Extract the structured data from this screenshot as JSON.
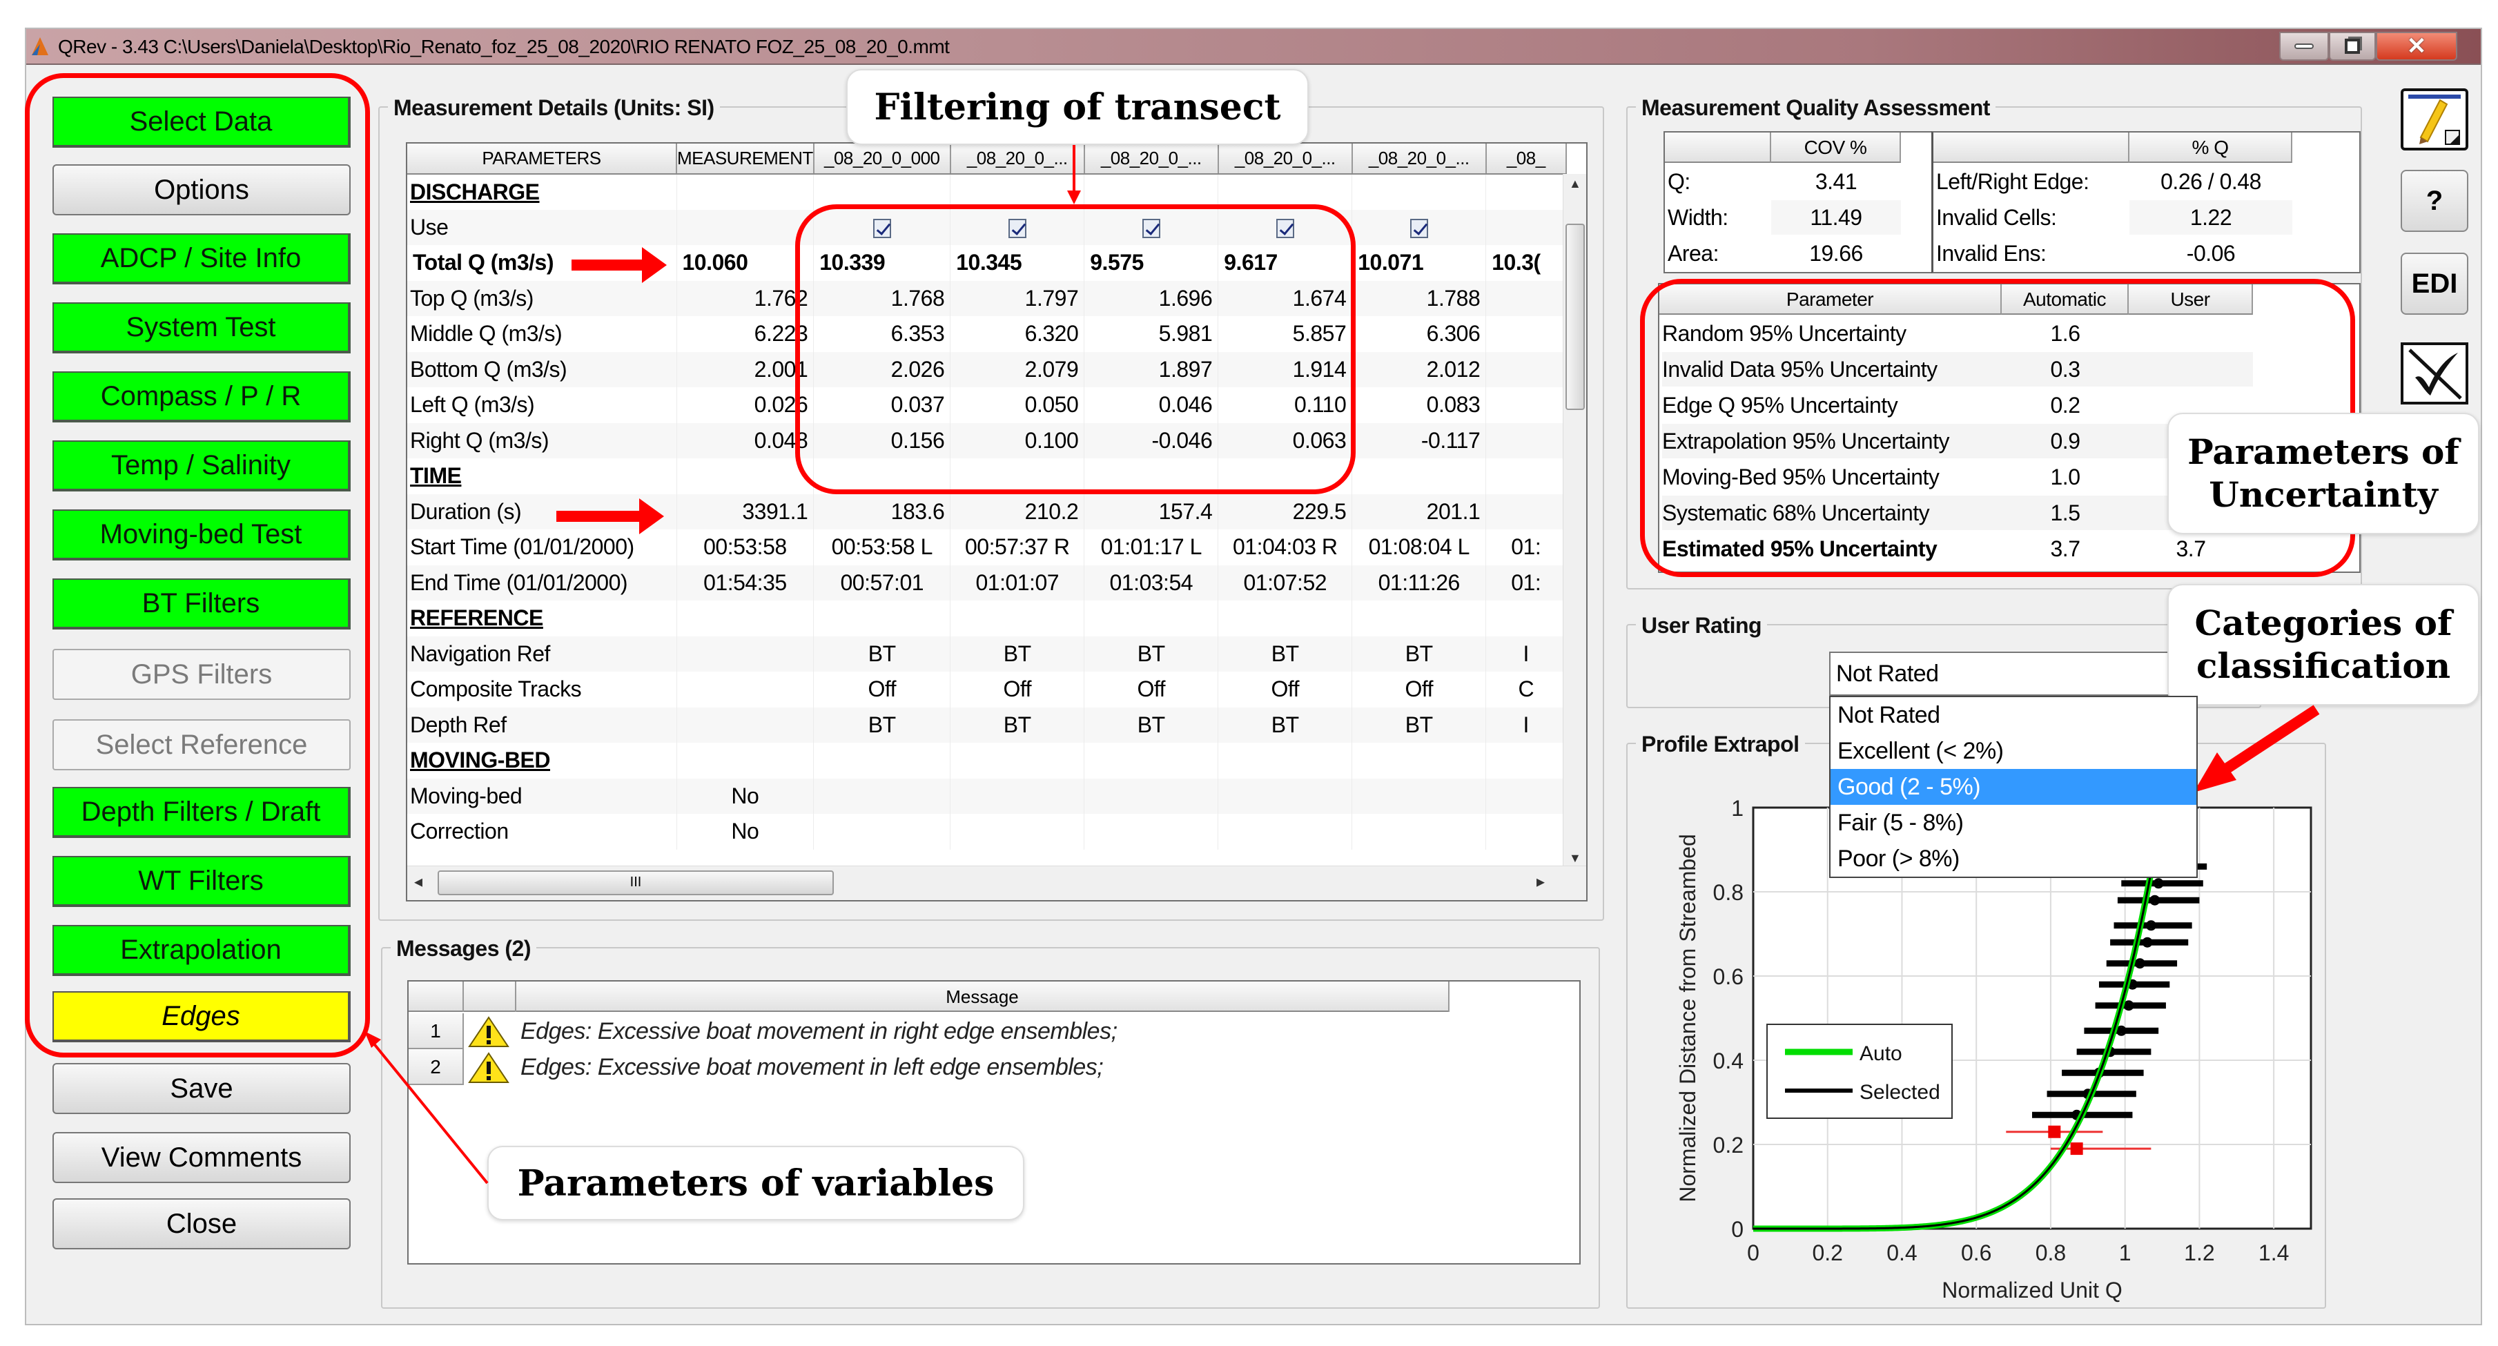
{
  "window": {
    "title": "QRev - 3.43    C:\\Users\\Daniela\\Desktop\\Rio_Renato_foz_25_08_2020\\RIO RENATO FOZ_25_08_20_0.mmt",
    "controls": [
      "minimize",
      "restore",
      "close"
    ]
  },
  "nav": {
    "buttons": [
      {
        "label": "Select Data",
        "state": "green"
      },
      {
        "label": "Options",
        "state": "gray"
      },
      {
        "label": "ADCP / Site Info",
        "state": "green"
      },
      {
        "label": "System Test",
        "state": "green"
      },
      {
        "label": "Compass / P / R",
        "state": "green"
      },
      {
        "label": "Temp / Salinity",
        "state": "green"
      },
      {
        "label": "Moving-bed Test",
        "state": "green"
      },
      {
        "label": "BT Filters",
        "state": "green"
      },
      {
        "label": "GPS Filters",
        "state": "disabled"
      },
      {
        "label": "Select Reference",
        "state": "disabled"
      },
      {
        "label": "Depth Filters / Draft",
        "state": "green"
      },
      {
        "label": "WT Filters",
        "state": "green"
      },
      {
        "label": "Extrapolation",
        "state": "green"
      },
      {
        "label": "Edges",
        "state": "yellow"
      },
      {
        "label": "Save",
        "state": "gray"
      },
      {
        "label": "View Comments",
        "state": "gray"
      },
      {
        "label": "Close",
        "state": "gray"
      }
    ]
  },
  "details": {
    "title": "Measurement Details (Units: SI)",
    "columns": [
      "PARAMETERS",
      "MEASUREMENT",
      "_08_20_0_000",
      "_08_20_0_...",
      "_08_20_0_...",
      "_08_20_0_...",
      "_08_20_0_...",
      "_08_"
    ],
    "rows": [
      {
        "type": "section",
        "label": "DISCHARGE"
      },
      {
        "type": "check",
        "label": "Use",
        "values": [
          "",
          "1",
          "1",
          "1",
          "1",
          "1",
          ""
        ]
      },
      {
        "type": "bold",
        "label": "Total Q (m3/s)",
        "values": [
          "10.060",
          "10.339",
          "10.345",
          "9.575",
          "9.617",
          "10.071",
          "10.3("
        ]
      },
      {
        "type": "num",
        "label": "Top Q (m3/s)",
        "values": [
          "1.762",
          "1.768",
          "1.797",
          "1.696",
          "1.674",
          "1.788",
          ""
        ]
      },
      {
        "type": "num",
        "label": "Middle Q (m3/s)",
        "values": [
          "6.223",
          "6.353",
          "6.320",
          "5.981",
          "5.857",
          "6.306",
          ""
        ]
      },
      {
        "type": "num",
        "label": "Bottom Q (m3/s)",
        "values": [
          "2.001",
          "2.026",
          "2.079",
          "1.897",
          "1.914",
          "2.012",
          ""
        ]
      },
      {
        "type": "num",
        "label": "Left Q (m3/s)",
        "values": [
          "0.026",
          "0.037",
          "0.050",
          "0.046",
          "0.110",
          "0.083",
          ""
        ]
      },
      {
        "type": "num",
        "label": "Right Q (m3/s)",
        "values": [
          "0.048",
          "0.156",
          "0.100",
          "-0.046",
          "0.063",
          "-0.117",
          ""
        ]
      },
      {
        "type": "section",
        "label": "TIME"
      },
      {
        "type": "num",
        "label": "Duration (s)",
        "values": [
          "3391.1",
          "183.6",
          "210.2",
          "157.4",
          "229.5",
          "201.1",
          ""
        ]
      },
      {
        "type": "num",
        "label": "Start Time (01/01/2000)",
        "values": [
          "00:53:58",
          "00:53:58 L",
          "00:57:37 R",
          "01:01:17 L",
          "01:04:03 R",
          "01:08:04 L",
          "01:"
        ]
      },
      {
        "type": "num",
        "label": "End Time (01/01/2000)",
        "values": [
          "01:54:35",
          "00:57:01",
          "01:01:07",
          "01:03:54",
          "01:07:52",
          "01:11:26",
          "01:"
        ]
      },
      {
        "type": "section",
        "label": "REFERENCE"
      },
      {
        "type": "ctr",
        "label": "Navigation Ref",
        "values": [
          "",
          "BT",
          "BT",
          "BT",
          "BT",
          "BT",
          "I"
        ]
      },
      {
        "type": "ctr",
        "label": "Composite Tracks",
        "values": [
          "",
          "Off",
          "Off",
          "Off",
          "Off",
          "Off",
          "C"
        ]
      },
      {
        "type": "ctr",
        "label": "Depth Ref",
        "values": [
          "",
          "BT",
          "BT",
          "BT",
          "BT",
          "BT",
          "I"
        ]
      },
      {
        "type": "section",
        "label": "MOVING-BED"
      },
      {
        "type": "ctr",
        "label": "Moving-bed",
        "values": [
          "No",
          "",
          "",
          "",
          "",
          "",
          ""
        ]
      },
      {
        "type": "ctr",
        "label": "Correction",
        "values": [
          "No",
          "",
          "",
          "",
          "",
          "",
          ""
        ]
      }
    ],
    "hscroll_glyph": "III"
  },
  "messages": {
    "title": "Messages (2)",
    "column": "Message",
    "items": [
      {
        "num": "1",
        "text": "Edges: Excessive boat movement in right edge ensembles;"
      },
      {
        "num": "2",
        "text": "Edges: Excessive boat movement in left edge ensembles;"
      }
    ]
  },
  "quality": {
    "title": "Measurement Quality Assessment",
    "cov": {
      "header": "COV %",
      "rows": [
        {
          "label": "Q:",
          "value": "3.41"
        },
        {
          "label": "Width:",
          "value": "11.49"
        },
        {
          "label": "Area:",
          "value": "19.66"
        }
      ]
    },
    "pctq": {
      "header": "% Q",
      "rows": [
        {
          "label": "Left/Right Edge:",
          "value": "0.26 /   0.48"
        },
        {
          "label": "Invalid Cells:",
          "value": "1.22"
        },
        {
          "label": "Invalid Ens:",
          "value": "-0.06"
        }
      ]
    },
    "uncertainty": {
      "headers": [
        "Parameter",
        "Automatic",
        "User"
      ],
      "rows": [
        {
          "label": "Random 95% Uncertainty",
          "auto": "1.6",
          "user": ""
        },
        {
          "label": "Invalid Data 95% Uncertainty",
          "auto": "0.3",
          "user": ""
        },
        {
          "label": "Edge Q 95% Uncertainty",
          "auto": "0.2",
          "user": ""
        },
        {
          "label": "Extrapolation 95% Uncertainty",
          "auto": "0.9",
          "user": ""
        },
        {
          "label": "Moving-Bed 95% Uncertainty",
          "auto": "1.0",
          "user": ""
        },
        {
          "label": "Systematic 68% Uncertainty",
          "auto": "1.5",
          "user": ""
        },
        {
          "label": "Estimated 95% Uncertainty",
          "auto": "3.7",
          "user": "3.7",
          "bold": true
        }
      ]
    }
  },
  "rating": {
    "title": "User Rating",
    "selected": "Not Rated",
    "options": [
      "Not Rated",
      "Excellent (< 2%)",
      "Good (2 - 5%)",
      "Fair (5 - 8%)",
      "Poor (> 8%)"
    ],
    "highlighted": "Good (2 - 5%)"
  },
  "extrap": {
    "title": "Profile Extrapol"
  },
  "right_icons": [
    {
      "name": "comment-pencil-icon"
    },
    {
      "name": "help-button",
      "label": "?"
    },
    {
      "name": "edi-button",
      "label": "EDI"
    },
    {
      "name": "no-check-icon"
    }
  ],
  "annotations": {
    "filtering": "Filtering of transect",
    "uncertainty": "Parameters of Uncertainty",
    "uncertainty_l1": "Parameters of",
    "uncertainty_l2": "Uncertainty",
    "classification_l1": "Categories of",
    "classification_l2": "classification",
    "variables": "Parameters of variables",
    "accent": "#ff0000"
  },
  "chart_data": {
    "type": "scatter",
    "title": "Profile Extrapolation",
    "xlabel": "Normalized Unit Q",
    "ylabel": "Normalized Distance from Streambed",
    "xlim": [
      0,
      1.5
    ],
    "ylim": [
      0,
      1
    ],
    "xticks": [
      "0",
      "0.2",
      "0.4",
      "0.6",
      "0.8",
      "1",
      "1.2",
      "1.4"
    ],
    "yticks": [
      "0",
      "0.2",
      "0.4",
      "0.6",
      "0.8",
      "1"
    ],
    "grid": true,
    "legend": {
      "position": "center-left",
      "entries": [
        {
          "name": "Auto",
          "color": "#00dd00"
        },
        {
          "name": "Selected",
          "color": "#000000"
        }
      ]
    },
    "curve_exponent": 0.1667,
    "curve_scale": 1.1,
    "selected_bars": [
      {
        "y": 0.86,
        "x": 1.1,
        "xmin": 1.04,
        "xmax": 1.22
      },
      {
        "y": 0.82,
        "x": 1.09,
        "xmin": 0.99,
        "xmax": 1.21
      },
      {
        "y": 0.78,
        "x": 1.08,
        "xmin": 0.98,
        "xmax": 1.2
      },
      {
        "y": 0.72,
        "x": 1.07,
        "xmin": 0.97,
        "xmax": 1.18
      },
      {
        "y": 0.68,
        "x": 1.06,
        "xmin": 0.96,
        "xmax": 1.17
      },
      {
        "y": 0.63,
        "x": 1.04,
        "xmin": 0.95,
        "xmax": 1.14
      },
      {
        "y": 0.58,
        "x": 1.02,
        "xmin": 0.93,
        "xmax": 1.12
      },
      {
        "y": 0.53,
        "x": 1.01,
        "xmin": 0.92,
        "xmax": 1.11
      },
      {
        "y": 0.47,
        "x": 0.99,
        "xmin": 0.89,
        "xmax": 1.09
      },
      {
        "y": 0.42,
        "x": 0.96,
        "xmin": 0.87,
        "xmax": 1.07
      },
      {
        "y": 0.37,
        "x": 0.93,
        "xmin": 0.83,
        "xmax": 1.05
      },
      {
        "y": 0.32,
        "x": 0.9,
        "xmin": 0.79,
        "xmax": 1.03
      },
      {
        "y": 0.27,
        "x": 0.87,
        "xmin": 0.75,
        "xmax": 1.02
      }
    ],
    "excluded_points": [
      {
        "y": 0.23,
        "x": 0.81,
        "xmin": 0.68,
        "xmax": 0.94
      },
      {
        "y": 0.19,
        "x": 0.87,
        "xmin": 0.8,
        "xmax": 1.07
      }
    ]
  }
}
